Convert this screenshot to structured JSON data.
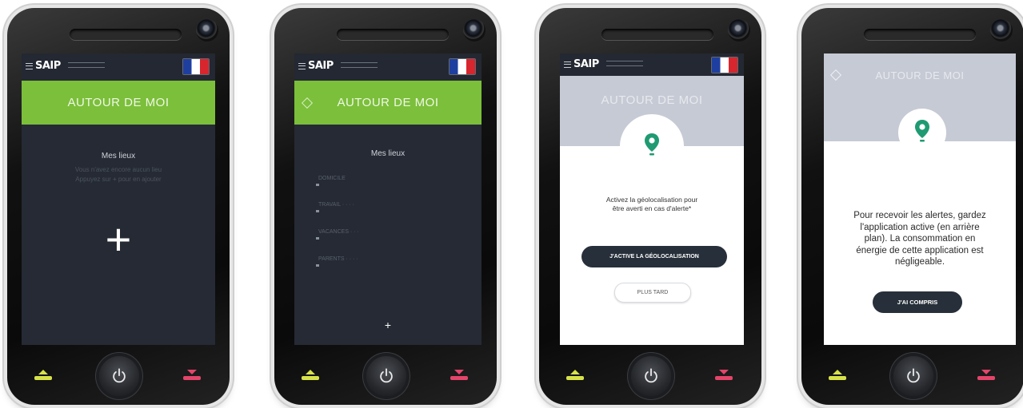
{
  "app": {
    "logo": "SAIP"
  },
  "screen1": {
    "header": "AUTOUR DE MOI",
    "section_title": "Mes lieux",
    "faint_line1": "Vous n'avez encore aucun lieu",
    "faint_line2": "Appuyez sur + pour en ajouter",
    "add_label": "+"
  },
  "screen2": {
    "header": "AUTOUR DE MOI",
    "section_title": "Mes lieux",
    "items": [
      "DOMICILE",
      "TRAVAIL · · · ·",
      "VACANCES · · ·",
      "PARENTS · · · ·"
    ],
    "add_label": "+"
  },
  "screen3": {
    "ghost_header": "AUTOUR DE MOI",
    "message_line1": "Activez la géolocalisation pour",
    "message_line2": "être averti en cas d'alerte*",
    "primary_button": "J'ACTIVE LA GÉOLOCALISATION",
    "secondary_button": "PLUS TARD"
  },
  "screen4": {
    "ghost_header": "AUTOUR DE MOI",
    "message_lines": [
      "Pour recevoir les alertes, gardez",
      "l'application active (en arrière",
      "plan). La consommation en",
      "énergie de cette application est",
      "négligeable."
    ],
    "primary_button": "J'AI COMPRIS"
  },
  "colors": {
    "green": "#7bbf3b",
    "accent_pin": "#1f9a72",
    "pickup": "#d7e24a",
    "hangup": "#e4456a"
  }
}
